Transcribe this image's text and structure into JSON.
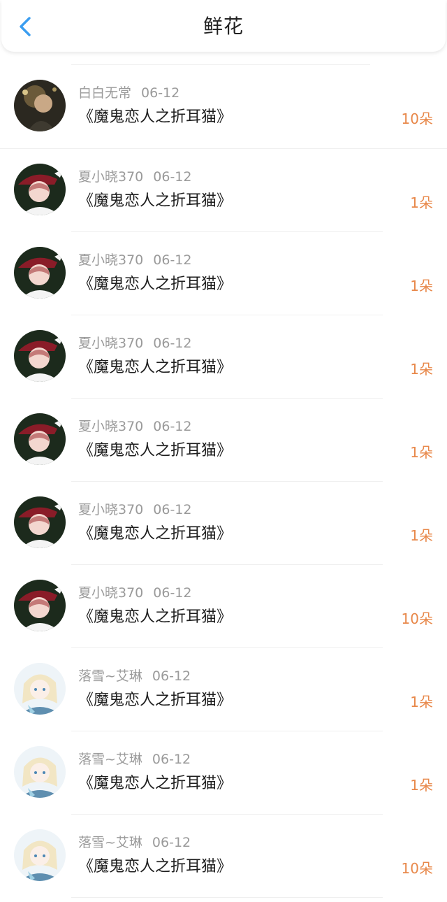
{
  "header": {
    "back_icon": "chevron-left-icon",
    "title": "鲜花",
    "accent": "#3a9df0"
  },
  "colors": {
    "count": "#e8884a",
    "meta": "#9a9a9a"
  },
  "items": [
    {
      "user": "白白无常",
      "date": "06-12",
      "book": "《魔鬼恋人之折耳猫》",
      "count": "10朵",
      "avatar": "avatar-dark-portrait"
    },
    {
      "user": "夏小晓370",
      "date": "06-12",
      "book": "《魔鬼恋人之折耳猫》",
      "count": "1朵",
      "avatar": "avatar-anime-red-hat"
    },
    {
      "user": "夏小晓370",
      "date": "06-12",
      "book": "《魔鬼恋人之折耳猫》",
      "count": "1朵",
      "avatar": "avatar-anime-red-hat"
    },
    {
      "user": "夏小晓370",
      "date": "06-12",
      "book": "《魔鬼恋人之折耳猫》",
      "count": "1朵",
      "avatar": "avatar-anime-red-hat"
    },
    {
      "user": "夏小晓370",
      "date": "06-12",
      "book": "《魔鬼恋人之折耳猫》",
      "count": "1朵",
      "avatar": "avatar-anime-red-hat"
    },
    {
      "user": "夏小晓370",
      "date": "06-12",
      "book": "《魔鬼恋人之折耳猫》",
      "count": "1朵",
      "avatar": "avatar-anime-red-hat"
    },
    {
      "user": "夏小晓370",
      "date": "06-12",
      "book": "《魔鬼恋人之折耳猫》",
      "count": "10朵",
      "avatar": "avatar-anime-red-hat"
    },
    {
      "user": "落雪~艾琳",
      "date": "06-12",
      "book": "《魔鬼恋人之折耳猫》",
      "count": "1朵",
      "avatar": "avatar-anime-blonde"
    },
    {
      "user": "落雪~艾琳",
      "date": "06-12",
      "book": "《魔鬼恋人之折耳猫》",
      "count": "1朵",
      "avatar": "avatar-anime-blonde"
    },
    {
      "user": "落雪~艾琳",
      "date": "06-12",
      "book": "《魔鬼恋人之折耳猫》",
      "count": "10朵",
      "avatar": "avatar-anime-blonde"
    }
  ]
}
